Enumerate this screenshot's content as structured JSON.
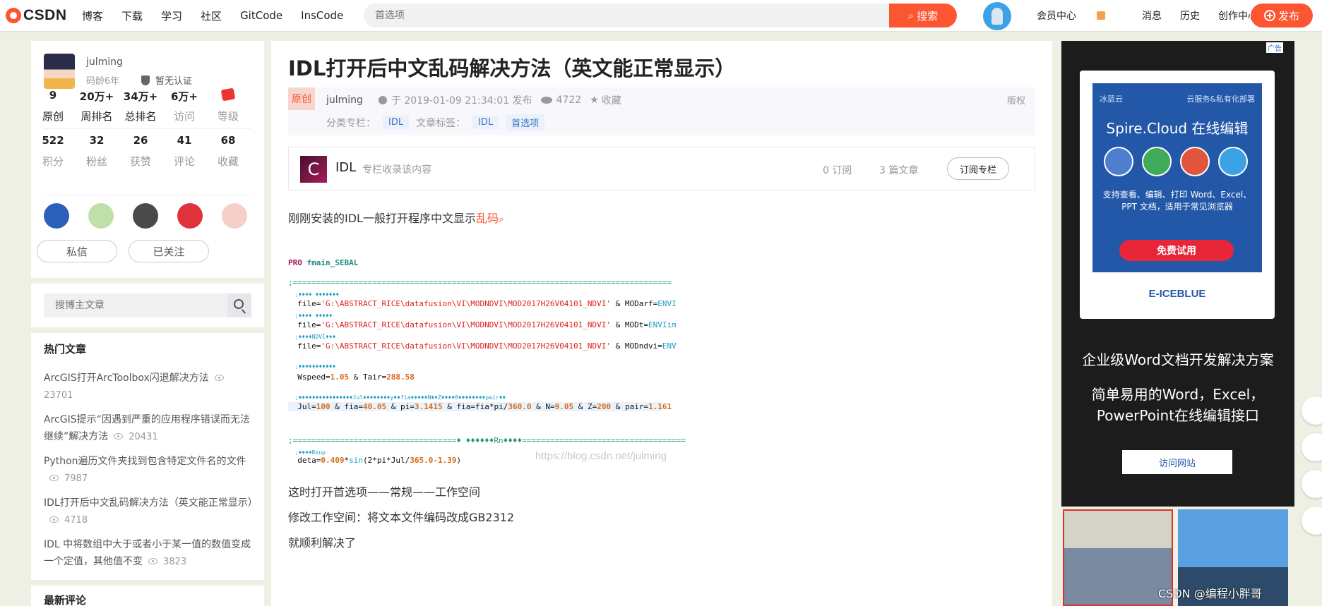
{
  "nav": {
    "logo": "CSDN",
    "links": [
      "博客",
      "下载",
      "学习",
      "社区",
      "GitCode",
      "InsCode"
    ],
    "search_placeholder": "首选项",
    "search_button": "搜索",
    "right_links": [
      "会员中心",
      "消息",
      "历史",
      "创作中心"
    ],
    "publish": "发布"
  },
  "profile": {
    "name": "julming",
    "age": "码龄6年",
    "cert": "暂无认证",
    "stats1": [
      {
        "num": "9",
        "label": "原创"
      },
      {
        "num": "20万+",
        "label": "周排名"
      },
      {
        "num": "34万+",
        "label": "总排名"
      },
      {
        "num": "6万+",
        "label": "访问"
      },
      {
        "num": "",
        "label": "等级"
      }
    ],
    "stats2": [
      {
        "num": "522",
        "label": "积分"
      },
      {
        "num": "32",
        "label": "粉丝"
      },
      {
        "num": "26",
        "label": "获赞"
      },
      {
        "num": "41",
        "label": "评论"
      },
      {
        "num": "68",
        "label": "收藏"
      }
    ],
    "message_btn": "私信",
    "follow_btn": "已关注"
  },
  "sidebar_search": {
    "placeholder": "搜博主文章"
  },
  "hot": {
    "title": "热门文章",
    "items": [
      {
        "title": "ArcGIS打开ArcToolbox闪退解决方法",
        "views": "23701"
      },
      {
        "title": "ArcGIS提示“因遇到严重的应用程序错误而无法继续”解决方法",
        "views": "20431"
      },
      {
        "title": "Python遍历文件夹找到包含特定文件名的文件",
        "views": "7987"
      },
      {
        "title": "IDL打开后中文乱码解决方法（英文能正常显示）",
        "views": "4718"
      },
      {
        "title": "IDL 中将数组中大于或者小于某一值的数值变成一个定值，其他值不变",
        "views": "3823"
      }
    ]
  },
  "latest": {
    "title": "最新评论"
  },
  "article": {
    "title": "IDL打开后中文乱码解决方法（英文能正常显示）",
    "original": "原创",
    "author": "julming",
    "date": "于 2019-01-09 21:34:01 发布",
    "views": "4722",
    "favorite": "收藏",
    "copyright": "版权",
    "category_label": "分类专栏：",
    "category": "IDL",
    "tags_label": "文章标签：",
    "tags": [
      "IDL",
      "首选项"
    ],
    "column": {
      "icon": "C",
      "name": "IDL",
      "desc": "专栏收录该内容",
      "subs": "0 订阅",
      "arts": "3 篇文章",
      "subscribe": "订阅专栏"
    },
    "p1": "刚刚安装的IDL一般打开程序中文显示",
    "p1_link": "乱码",
    "watermark": "https://blog.csdn.net/julming",
    "p2": "这时打开首选项——常规——工作空间",
    "p3": "修改工作空间：将文本文件编码改成GB2312",
    "p4": "就顺利解决了"
  },
  "ad": {
    "tag": "广告",
    "brand_left": "冰蓝云",
    "brand_right": "云服务&私有化部署",
    "headline": "Spire.Cloud 在线编辑",
    "desc": "支持查看、编辑、打印 Word、Excel、PPT 文档，适用于常见浏览器",
    "try_btn": "免费试用",
    "logo": "E-ICEBLUE",
    "line1": "企业级Word文档开发解决方案",
    "line2a": "简单易用的Word，Excel，",
    "line2b": "PowerPoint在线编辑接口",
    "visit": "访问网站"
  },
  "thumb_caption": "CSDN @编程小胖哥"
}
